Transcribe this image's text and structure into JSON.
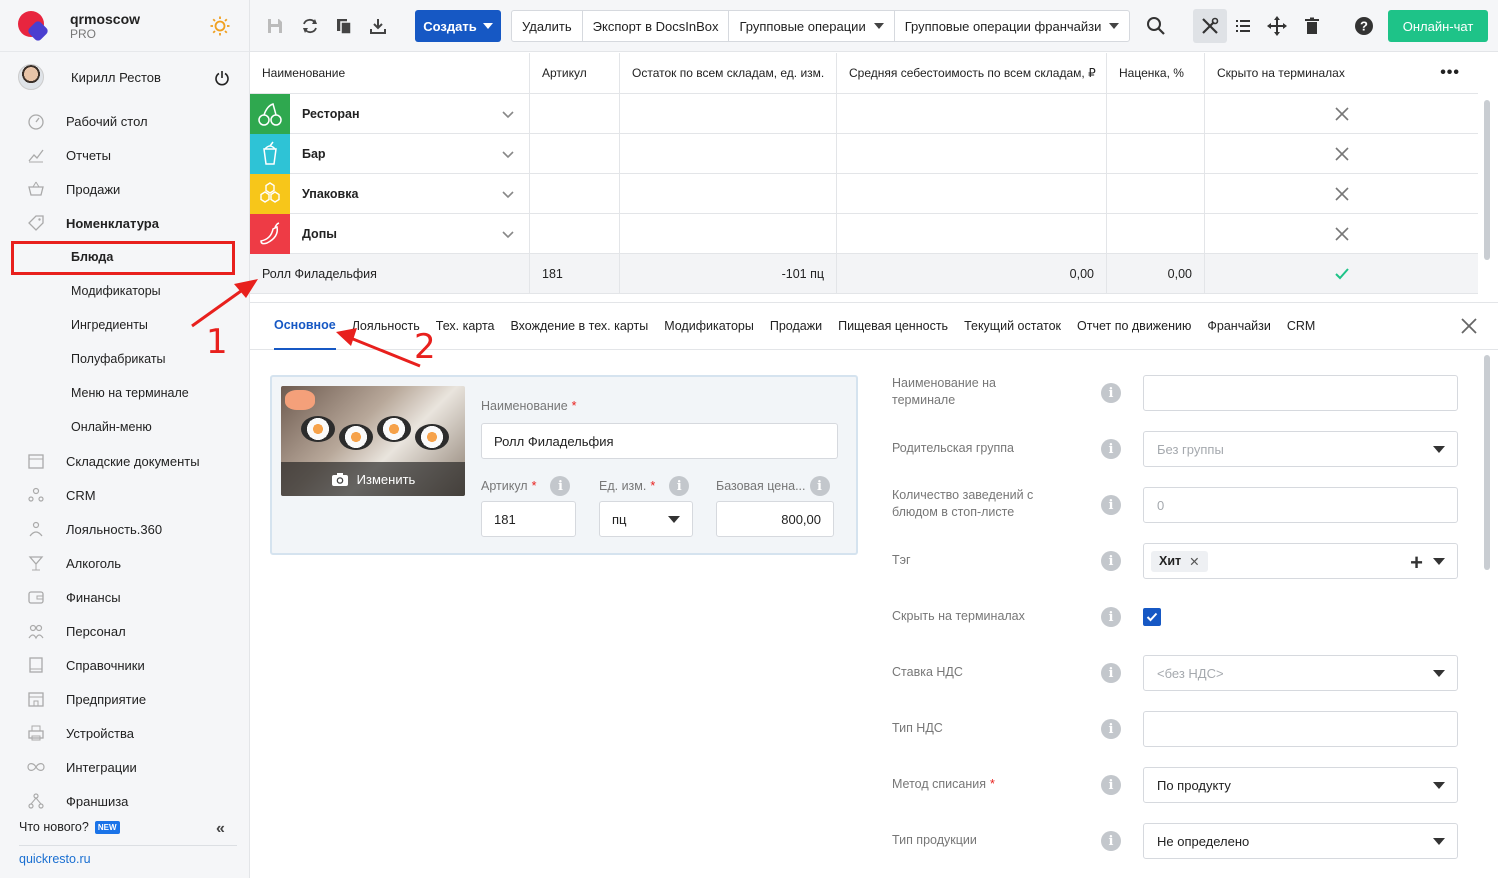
{
  "brand": {
    "name": "qrmoscow",
    "plan": "PRO"
  },
  "user": {
    "name": "Кирилл Рестов"
  },
  "nav": {
    "desktop": "Рабочий стол",
    "reports": "Отчеты",
    "sales": "Продажи",
    "nomenclature": "Номенклатура",
    "dishes": "Блюда",
    "modifiers": "Модификаторы",
    "ingredients": "Ингредиенты",
    "semi": "Полуфабрикаты",
    "terminal_menu": "Меню на терминале",
    "online_menu": "Онлайн-меню",
    "warehouse_docs": "Складские документы",
    "crm": "CRM",
    "loyalty": "Лояльность.360",
    "alcohol": "Алкоголь",
    "finance": "Финансы",
    "staff": "Персонал",
    "refs": "Справочники",
    "enterprise": "Предприятие",
    "devices": "Устройства",
    "integrations": "Интеграции",
    "franchise": "Франшиза"
  },
  "whats_new": "Что нового?",
  "new_badge": "NEW",
  "footer_link": "quickresto.ru",
  "toolbar": {
    "create": "Создать",
    "delete": "Удалить",
    "export": "Экспорт в DocsInBox",
    "group_ops": "Групповые операции",
    "group_ops_fr": "Групповые операции франчайзи",
    "online_chat": "Онлайн-чат"
  },
  "table": {
    "headers": {
      "name": "Наименование",
      "article": "Артикул",
      "stock": "Остаток по всем складам, ед. изм.",
      "cost": "Средняя себестоимость по всем складам, ₽",
      "markup": "Наценка, %",
      "hidden": "Скрыто на терминалах"
    },
    "categories": {
      "c0": "Ресторан",
      "c1": "Бар",
      "c2": "Упаковка",
      "c3": "Допы"
    },
    "item": {
      "name": "Ролл Филадельфия",
      "article": "181",
      "stock": "-101 пц",
      "cost": "0,00",
      "markup": "0,00"
    }
  },
  "tabs": {
    "t0": "Основное",
    "t1": "Лояльность",
    "t2": "Тех. карта",
    "t3": "Вхождение в тех. карты",
    "t4": "Модификаторы",
    "t5": "Продажи",
    "t6": "Пищевая ценность",
    "t7": "Текущий остаток",
    "t8": "Отчет по движению",
    "t9": "Франчайзи",
    "t10": "CRM"
  },
  "form": {
    "photo_change": "Изменить",
    "name_label": "Наименование",
    "name_value": "Ролл Филадельфия",
    "article_label": "Артикул",
    "article_value": "181",
    "unit_label": "Ед. изм.",
    "unit_value": "пц",
    "price_label": "Базовая цена...",
    "price_value": "800,00",
    "terminal_name_label": "Наименование на терминале",
    "parent_group_label": "Родительская группа",
    "parent_group_value": "Без группы",
    "stoplist_label": "Количество заведений с блюдом в стоп-листе",
    "stoplist_value": "0",
    "tag_label": "Тэг",
    "tag_value": "Хит",
    "hide_label": "Скрыть на терминалах",
    "vat_rate_label": "Ставка НДС",
    "vat_rate_value": "<без НДС>",
    "vat_type_label": "Тип НДС",
    "writeoff_label": "Метод списания",
    "writeoff_value": "По продукту",
    "product_type_label": "Тип продукции",
    "product_type_value": "Не определено"
  },
  "annotations": {
    "n1": "1",
    "n2": "2"
  },
  "colors": {
    "accent": "#1658c4",
    "online": "#1ec388",
    "annotation": "#e8201d",
    "cat_restaurant": "#2fa84f",
    "cat_bar": "#2ec3d6",
    "cat_pack": "#f7c61a",
    "cat_extras": "#ee3b45"
  }
}
